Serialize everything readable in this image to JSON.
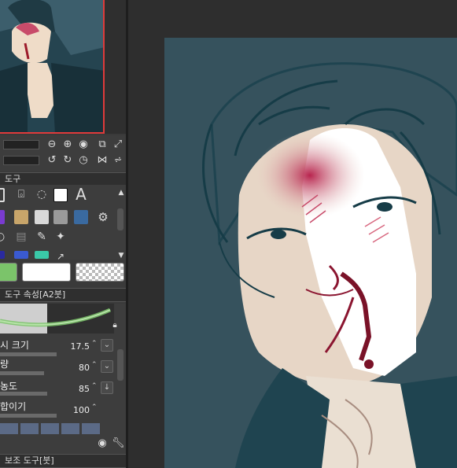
{
  "panels": {
    "tool_title": "도구",
    "tool_property_title": "도구 속성[A2붓]",
    "sub_tool_title": "보조 도구[붓]"
  },
  "tool_property": {
    "brush_size_label": "시 크기",
    "brush_size_value": "17.5",
    "opacity_label": "량",
    "opacity_value": "80",
    "density_label": "농도",
    "density_value": "85",
    "blend_label": "합이기",
    "blend_value": "100"
  },
  "tools": {
    "text_tool_glyph": "A"
  },
  "colors": {
    "main_color": "#7bc46a",
    "sub_color": "#ffffff",
    "navigator_border": "#e03a3a",
    "canvas_bg": "#36525d"
  }
}
